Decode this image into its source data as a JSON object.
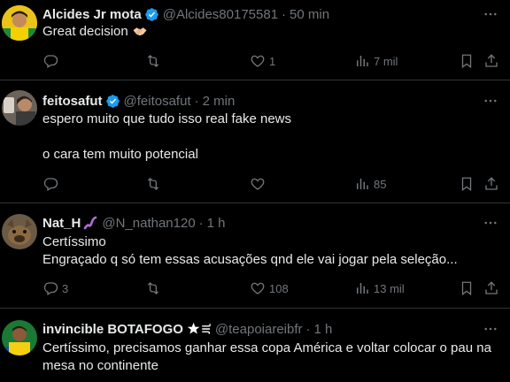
{
  "colors": {
    "background": "#000000",
    "text": "#e7e9ea",
    "secondary": "#71767b",
    "divider": "#2f3336",
    "verified": "#1d9bf0"
  },
  "tweets": [
    {
      "name": "Alcides Jr mota",
      "handle": "@Alcides80175581",
      "separator": "·",
      "time": "50 min",
      "verified": true,
      "lines": [
        "Great decision"
      ],
      "emoji": "handshake",
      "replies": "",
      "retweets": "",
      "likes": "1",
      "views": "7 mil"
    },
    {
      "name": "feitosafut",
      "handle": "@feitosafut",
      "separator": "·",
      "time": "2 min",
      "verified": true,
      "lines": [
        "espero muito que tudo isso real fake news",
        "",
        "o cara tem muito potencial"
      ],
      "replies": "",
      "retweets": "",
      "likes": "",
      "views": "85"
    },
    {
      "name": "Nat_H",
      "handle": "@N_nathan120",
      "separator": "·",
      "time": "1 h",
      "name_emoji": "worm",
      "verified": false,
      "lines": [
        "Certíssimo",
        "Engraçado q só tem essas acusações qnd ele vai jogar pela seleção..."
      ],
      "replies": "3",
      "retweets": "",
      "likes": "108",
      "views": "13 mil"
    },
    {
      "name": "invincible BOTAFOGO",
      "handle": "@teapoiareibfr",
      "separator": "·",
      "time": "1 h",
      "name_emoji": "star-wind",
      "verified": false,
      "lines": [
        "Certíssimo, precisamos ganhar essa copa América e voltar colocar o pau na",
        "mesa no continente"
      ]
    }
  ]
}
